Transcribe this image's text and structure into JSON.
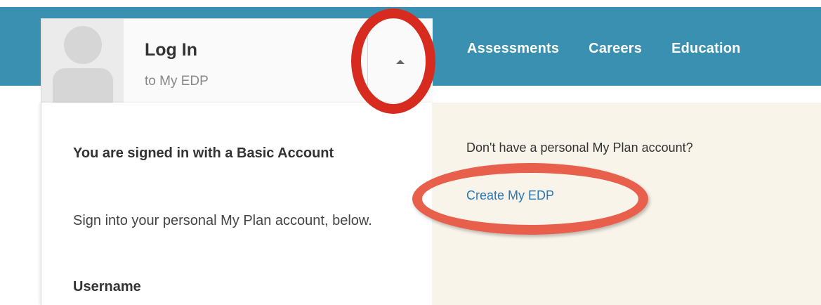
{
  "header": {
    "nav": [
      "Assessments",
      "Careers",
      "Education"
    ]
  },
  "login": {
    "title": "Log In",
    "subtitle": "to My EDP"
  },
  "dropdown": {
    "heading": "You are signed in with a Basic Account",
    "description": "Sign into your personal My Plan account, below.",
    "username_label": "Username",
    "no_account_text": "Don't have a personal My Plan account?",
    "create_link": "Create My EDP"
  },
  "colors": {
    "header_bg": "#3a90b0",
    "annotation_red": "#d72b1f",
    "annotation_coral": "#e85f4c",
    "link": "#2a77b6"
  }
}
